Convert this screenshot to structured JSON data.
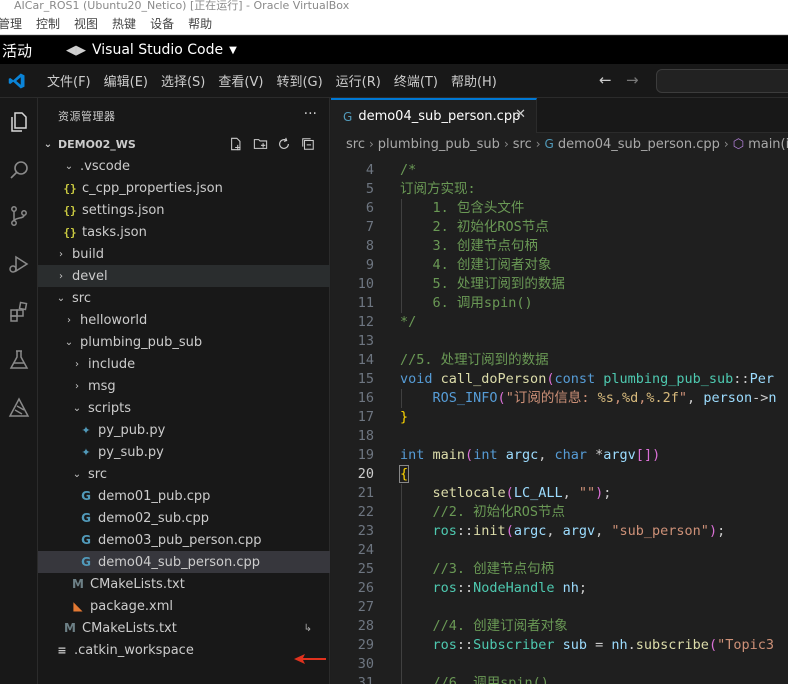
{
  "vbox": {
    "title": "AICar_ROS1 (Ubuntu20_Netico) [正在运行] - Oracle VirtualBox",
    "menu": [
      "管理",
      "控制",
      "视图",
      "热键",
      "设备",
      "帮助"
    ]
  },
  "gnome": {
    "activities": "活动",
    "app_name": "Visual Studio Code"
  },
  "menubar": {
    "items": [
      "文件(F)",
      "编辑(E)",
      "选择(S)",
      "查看(V)",
      "转到(G)",
      "运行(R)",
      "终端(T)",
      "帮助(H)"
    ]
  },
  "activity_bar": {
    "icons": [
      "explorer-icon",
      "search-icon",
      "source-control-icon",
      "run-debug-icon",
      "extensions-icon",
      "testing-icon",
      "ros-icon"
    ]
  },
  "sidebar": {
    "title": "资源管理器",
    "more": "···",
    "workspace": "DEMO02_WS",
    "tree": [
      {
        "label": ".vscode",
        "type": "folder-open"
      },
      {
        "label": "c_cpp_properties.json",
        "type": "json"
      },
      {
        "label": "settings.json",
        "type": "json"
      },
      {
        "label": "tasks.json",
        "type": "json"
      },
      {
        "label": "build",
        "type": "folder-closed"
      },
      {
        "label": "devel",
        "type": "folder-closed"
      },
      {
        "label": "src",
        "type": "folder-open"
      },
      {
        "label": "helloworld",
        "type": "folder-closed"
      },
      {
        "label": "plumbing_pub_sub",
        "type": "folder-open"
      },
      {
        "label": "include",
        "type": "folder-closed"
      },
      {
        "label": "msg",
        "type": "folder-closed"
      },
      {
        "label": "scripts",
        "type": "folder-open"
      },
      {
        "label": "py_pub.py",
        "type": "py"
      },
      {
        "label": "py_sub.py",
        "type": "py"
      },
      {
        "label": "src",
        "type": "folder-open"
      },
      {
        "label": "demo01_pub.cpp",
        "type": "cpp"
      },
      {
        "label": "demo02_sub.cpp",
        "type": "cpp"
      },
      {
        "label": "demo03_pub_person.cpp",
        "type": "cpp"
      },
      {
        "label": "demo04_sub_person.cpp",
        "type": "cpp"
      },
      {
        "label": "CMakeLists.txt",
        "type": "cmake"
      },
      {
        "label": "package.xml",
        "type": "xml"
      },
      {
        "label": "CMakeLists.txt",
        "type": "cmake"
      },
      {
        "label": ".catkin_workspace",
        "type": "plain"
      }
    ]
  },
  "tab": {
    "label": "demo04_sub_person.cpp",
    "close": "✕"
  },
  "breadcrumb": {
    "parts": [
      "src",
      "plumbing_pub_sub",
      "src",
      "demo04_sub_person.cpp",
      "main(in"
    ]
  },
  "editor": {
    "lines": [
      {
        "n": "4",
        "t": "/*"
      },
      {
        "n": "5",
        "t": "订阅方实现:"
      },
      {
        "n": "6",
        "t": "    1. 包含头文件"
      },
      {
        "n": "7",
        "t": "    2. 初始化ROS节点"
      },
      {
        "n": "8",
        "t": "    3. 创建节点句柄"
      },
      {
        "n": "9",
        "t": "    4. 创建订阅者对象"
      },
      {
        "n": "10",
        "t": "    5. 处理订阅到的数据"
      },
      {
        "n": "11",
        "t": "    6. 调用spin()"
      },
      {
        "n": "12",
        "t": "*/"
      },
      {
        "n": "13",
        "t": ""
      },
      {
        "n": "14",
        "t": "//5. 处理订阅到的数据"
      },
      {
        "n": "15",
        "t": "void call_doPerson(const plumbing_pub_sub::Per"
      },
      {
        "n": "16",
        "t": "    ROS_INFO(\"订阅的信息: %s,%d,%.2f\", person->n"
      },
      {
        "n": "17",
        "t": "}"
      },
      {
        "n": "18",
        "t": ""
      },
      {
        "n": "19",
        "t": "int main(int argc, char *argv[])"
      },
      {
        "n": "20",
        "t": "{"
      },
      {
        "n": "21",
        "t": "    setlocale(LC_ALL, \"\");"
      },
      {
        "n": "22",
        "t": "    //2. 初始化ROS节点"
      },
      {
        "n": "23",
        "t": "    ros::init(argc, argv, \"sub_person\");"
      },
      {
        "n": "24",
        "t": ""
      },
      {
        "n": "25",
        "t": "    //3. 创建节点句柄"
      },
      {
        "n": "26",
        "t": "    ros::NodeHandle nh;"
      },
      {
        "n": "27",
        "t": ""
      },
      {
        "n": "28",
        "t": "    //4. 创建订阅者对象"
      },
      {
        "n": "29",
        "t": "    ros::Subscriber sub = nh.subscribe(\"Topic3"
      },
      {
        "n": "30",
        "t": ""
      },
      {
        "n": "31",
        "t": "    //6. 调用spin()"
      }
    ]
  }
}
